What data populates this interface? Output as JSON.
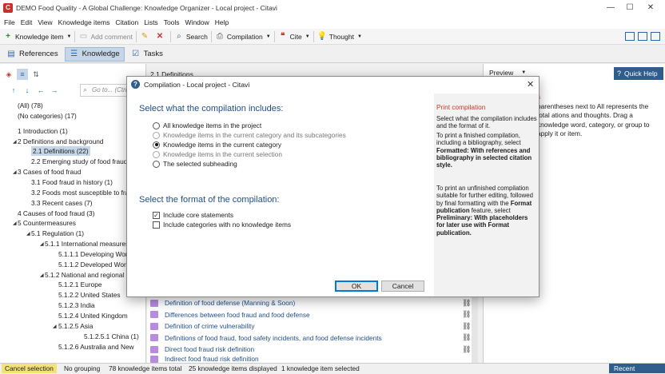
{
  "window": {
    "title": "DEMO Food Quality - A Global Challenge: Knowledge Organizer - Local project - Citavi",
    "app_icon": "C",
    "controls": [
      "—",
      "☐",
      "✕"
    ]
  },
  "menu": [
    "File",
    "Edit",
    "View",
    "Knowledge items",
    "Citation",
    "Lists",
    "Tools",
    "Window",
    "Help"
  ],
  "toolbar": {
    "knowledge_item": "Knowledge item",
    "add_comment": "Add comment",
    "search": "Search",
    "compilation": "Compilation",
    "cite": "Cite",
    "thought": "Thought"
  },
  "nav_tabs": [
    "References",
    "Knowledge",
    "Tasks"
  ],
  "quick_help": "Quick Help",
  "goto_placeholder": "Go to... (Ctrl+",
  "center_header": "2.1 Definitions",
  "preview_label": "Preview",
  "tree": [
    {
      "label": "(All) (78)",
      "level": 0
    },
    {
      "label": "(No categories) (17)",
      "level": 0
    },
    {
      "label": "1 Introduction (1)",
      "level": 0
    },
    {
      "label": "2 Definitions and background",
      "level": 0
    },
    {
      "label": "2.1 Definitions (22)",
      "level": 1,
      "selected": true
    },
    {
      "label": "2.2 Emerging study of food fraud (",
      "level": 1
    },
    {
      "label": "3 Cases of food fraud",
      "level": 0
    },
    {
      "label": "3.1 Food fraud in history (1)",
      "level": 1
    },
    {
      "label": "3.2 Foods most susceptible to frau",
      "level": 1
    },
    {
      "label": "3.3 Recent cases (7)",
      "level": 1
    },
    {
      "label": "4 Causes of food fraud (3)",
      "level": 0
    },
    {
      "label": "5 Countermeasures",
      "level": 0
    },
    {
      "label": "5.1 Regulation (1)",
      "level": 1
    },
    {
      "label": "5.1.1 International measures",
      "level": 2
    },
    {
      "label": "5.1.1.1 Developing Worl",
      "level": 3
    },
    {
      "label": "5.1.1.2 Developed World",
      "level": 3
    },
    {
      "label": "5.1.2 National and regional m",
      "level": 2
    },
    {
      "label": "5.1.2.1 Europe",
      "level": 3
    },
    {
      "label": "5.1.2.2 United States",
      "level": 3
    },
    {
      "label": "5.1.2.3 India",
      "level": 3
    },
    {
      "label": "5.1.2.4 United Kingdom",
      "level": 3
    },
    {
      "label": "5.1.2.5 Asia",
      "level": 3
    },
    {
      "label": "5.1.2.5.1 China (1)",
      "level": 4
    },
    {
      "label": "5.1.2.6 Australia and New",
      "level": 3
    }
  ],
  "center_list": [
    "Definition of food defense (Manning & Soon)",
    "Differences between food fraud and food defense",
    "Definition of crime vulnerability",
    "Definitions of food fraud, food safety incidents, and food defense incidents",
    "Direct food fraud risk definition",
    "Indirect food fraud risk definition"
  ],
  "right_panel_text": "parentheses next to All represents the total ations and thoughts. Drag a knowledge word, category, or group to apply it or item.",
  "right_panel_fragment": "s",
  "status": {
    "cancel_selection": "Cancel selection",
    "grouping": "No grouping",
    "total": "78 knowledge items total",
    "displayed": "25 knowledge items displayed",
    "selected": "1 knowledge item selected",
    "recent_changes": "Recent changes"
  },
  "dialog": {
    "title": "Compilation - Local project - Citavi",
    "section1_heading": "Select what the compilation includes:",
    "section1_options": [
      {
        "label": "All knowledge items in the project",
        "disabled": false,
        "checked": false
      },
      {
        "label": "Knowledge items in the current category and its subcategories",
        "disabled": true,
        "checked": false
      },
      {
        "label": "Knowledge items in the current category",
        "disabled": false,
        "checked": true
      },
      {
        "label": "Knowledge items in the current selection",
        "disabled": true,
        "checked": false
      },
      {
        "label": "The selected subheading",
        "disabled": false,
        "checked": false
      }
    ],
    "section2_heading": "Select the format of the compilation:",
    "section2_options": [
      {
        "label": "Include core statements",
        "checked": true
      },
      {
        "label": "Include categories with no knowledge items",
        "checked": false
      }
    ],
    "ok": "OK",
    "cancel": "Cancel",
    "help": {
      "title": "Print compilation",
      "p1": "Select what the compilation includes and the format of it.",
      "p2_plain": "To print a finished compilation, including a bibliography, select ",
      "p2_bold": "Formatted: With references and bibliography in selected citation style.",
      "p3_plain1": "To print an unfinished compilation suitable for further editing, followed by final formatting with the ",
      "p3_bold1": "Format publication",
      "p3_plain2": " feature, select ",
      "p3_bold2": "Preliminary: With placeholders for later use with Format publication."
    }
  }
}
